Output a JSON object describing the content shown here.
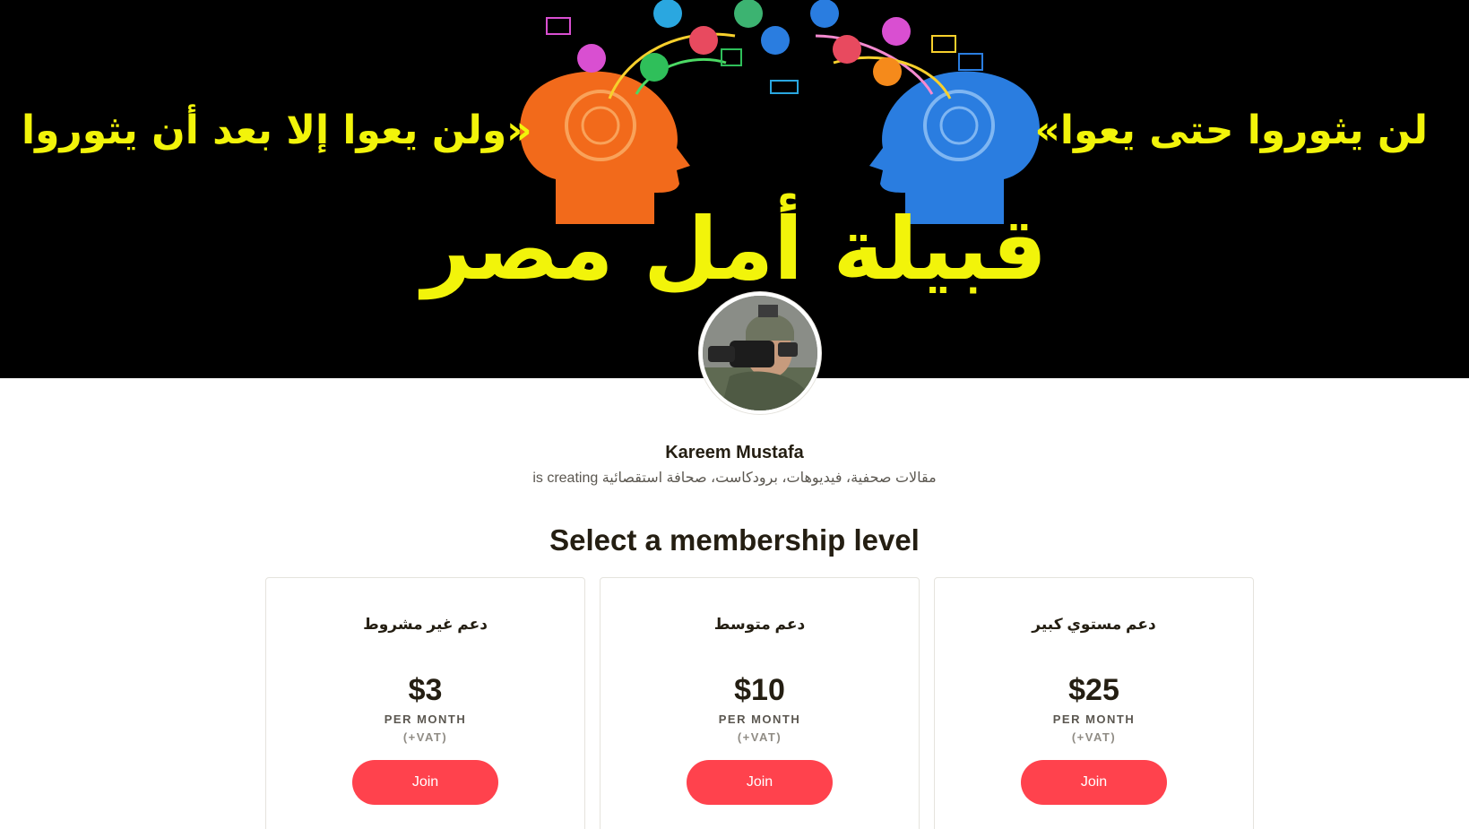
{
  "cover": {
    "quote_left": "ولن يعوا إلا بعد أن يثوروا»",
    "quote_right": "«لن يثوروا حتى يعوا",
    "title": "قبيلة أمل مصر"
  },
  "creator": {
    "name": "Kareem Mustafa",
    "tagline": "مقالات صحفية، فيديوهات، برودكاست، صحافة استقصائية is creating"
  },
  "membership": {
    "title": "Select a membership level",
    "tiers": [
      {
        "name": "دعم غير مشروط",
        "price": "$3",
        "period": "PER MONTH",
        "vat": "(+VAT)",
        "button": "Join"
      },
      {
        "name": "دعم متوسط",
        "price": "$10",
        "period": "PER MONTH",
        "vat": "(+VAT)",
        "button": "Join"
      },
      {
        "name": "دعم مستوي كبير",
        "price": "$25",
        "period": "PER MONTH",
        "vat": "(+VAT)",
        "button": "Join"
      }
    ]
  },
  "colors": {
    "accent": "#ff424d",
    "cover_text": "#f2f40a",
    "head_left": "#f26a1b",
    "head_right": "#2a7de0"
  }
}
